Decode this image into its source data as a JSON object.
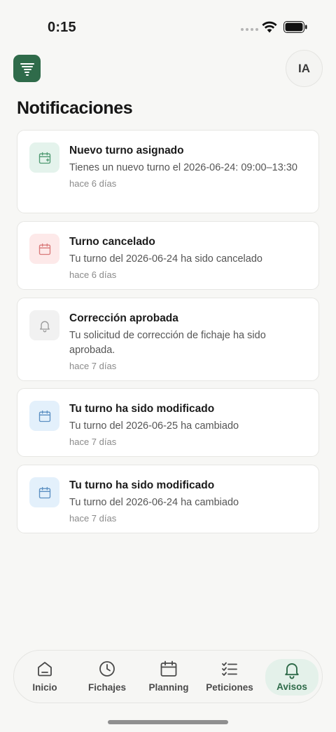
{
  "status_bar": {
    "time": "0:15"
  },
  "header": {
    "avatar_initials": "IA",
    "title": "Notificaciones"
  },
  "notifications": [
    {
      "icon": "calendar-plus-icon",
      "tint": "green",
      "title": "Nuevo turno asignado",
      "text": "Tienes un nuevo turno el 2026-06-24: 09:00–13:30",
      "time": "hace 6 días"
    },
    {
      "icon": "calendar-icon",
      "tint": "red",
      "title": "Turno cancelado",
      "text": "Tu turno del 2026-06-24 ha sido cancelado",
      "time": "hace 6 días"
    },
    {
      "icon": "bell-icon",
      "tint": "gray",
      "title": "Corrección aprobada",
      "text": "Tu solicitud de corrección de fichaje ha sido aprobada.",
      "time": "hace 7 días"
    },
    {
      "icon": "calendar-icon",
      "tint": "blue",
      "title": "Tu turno ha sido modificado",
      "text": "Tu turno del 2026-06-25 ha cambiado",
      "time": "hace 7 días"
    },
    {
      "icon": "calendar-icon",
      "tint": "blue",
      "title": "Tu turno ha sido modificado",
      "text": "Tu turno del 2026-06-24 ha cambiado",
      "time": "hace 7 días"
    }
  ],
  "tabs": [
    {
      "label": "Inicio",
      "icon": "home-icon"
    },
    {
      "label": "Fichajes",
      "icon": "clock-icon"
    },
    {
      "label": "Planning",
      "icon": "calendar-icon"
    },
    {
      "label": "Peticiones",
      "icon": "checklist-icon"
    },
    {
      "label": "Avisos",
      "icon": "bell-icon",
      "active": true
    }
  ],
  "colors": {
    "brand": "#2f6b4a",
    "green_bg": "#e4f3ec",
    "green_fg": "#4f9a72",
    "red_bg": "#fde9e9",
    "red_fg": "#d97a7a",
    "gray_bg": "#f1f1f1",
    "gray_fg": "#9a9a9a",
    "blue_bg": "#e3f0fb",
    "blue_fg": "#5b8fc2"
  }
}
